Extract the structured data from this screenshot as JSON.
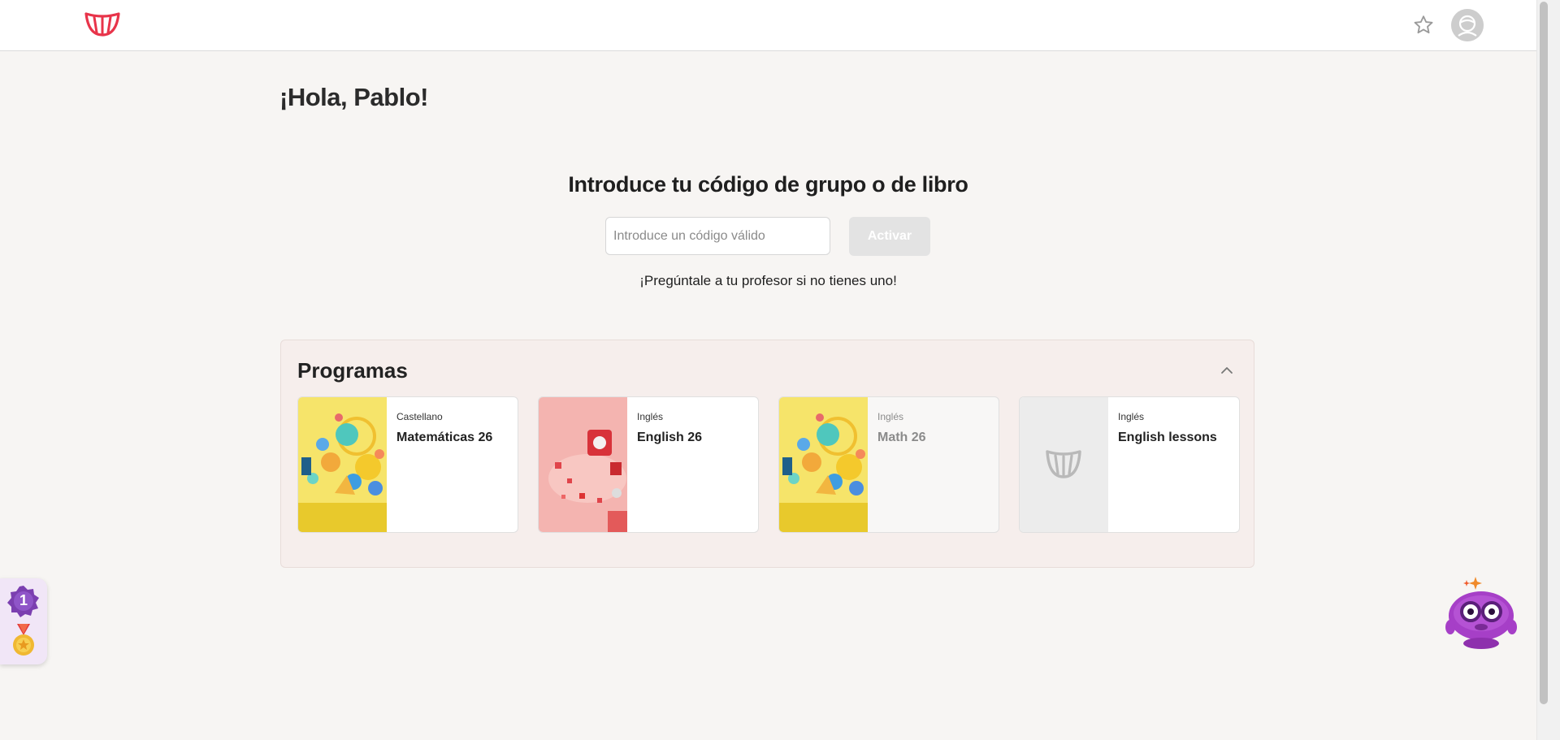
{
  "header": {
    "logo_icon": "smile-logo-icon",
    "favorite_icon": "star-icon",
    "avatar_icon": "user-avatar-icon"
  },
  "greeting": "¡Hola, Pablo!",
  "code_section": {
    "title": "Introduce tu código de grupo o de libro",
    "input_placeholder": "Introduce un código válido",
    "input_value": "",
    "activate_label": "Activar",
    "hint": "¡Pregúntale a tu profesor si no tienes uno!"
  },
  "programs": {
    "title": "Programas",
    "collapse_icon": "chevron-up-icon",
    "cards": [
      {
        "subject": "Castellano",
        "name": "Matemáticas 26",
        "thumb": "math-3d-shapes-image"
      },
      {
        "subject": "Inglés",
        "name": "English 26",
        "thumb": "english-pink-letters-image"
      },
      {
        "subject": "Inglés",
        "name": "Math 26",
        "thumb": "math-3d-shapes-image"
      },
      {
        "subject": "Inglés",
        "name": "English lessons",
        "thumb": "placeholder-logo-icon"
      }
    ]
  },
  "widgets": {
    "level_badge": "1",
    "medal_icon": "medal-icon",
    "assistant_icon": "robot-assistant-icon"
  },
  "colors": {
    "brand": "#e8344a",
    "background": "#f7f5f3",
    "panel": "#f6eeec"
  }
}
